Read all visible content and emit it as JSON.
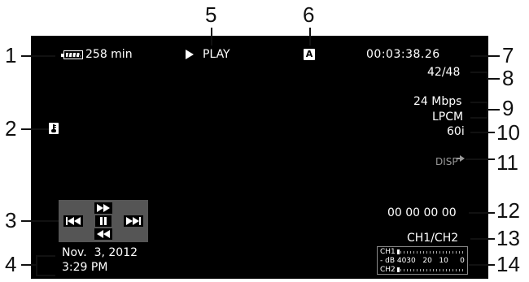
{
  "callouts": [
    "1",
    "2",
    "3",
    "4",
    "5",
    "6",
    "7",
    "8",
    "9",
    "10",
    "11",
    "12",
    "13",
    "14"
  ],
  "osd": {
    "battery_time": "258 min",
    "mode": "PLAY",
    "auto_badge": "A",
    "timecode": "00:03:38.26",
    "clip_counter": "42/48",
    "bitrate": "24 Mbps",
    "audio_format": "LPCM",
    "frame_rate": "60i",
    "disp_label": "DISP",
    "user_bit": "00 00 00 00",
    "channels": "CH1/CH2",
    "date": "Nov.  3, 2012",
    "time": "3:29 PM",
    "meter": {
      "ch1": "CH1",
      "ch2": "CH2",
      "scale": "- dB 4030   20   10     0"
    }
  },
  "colors": {
    "screen": "#000000",
    "control_panel": "#555555",
    "text": "#ffffff"
  }
}
